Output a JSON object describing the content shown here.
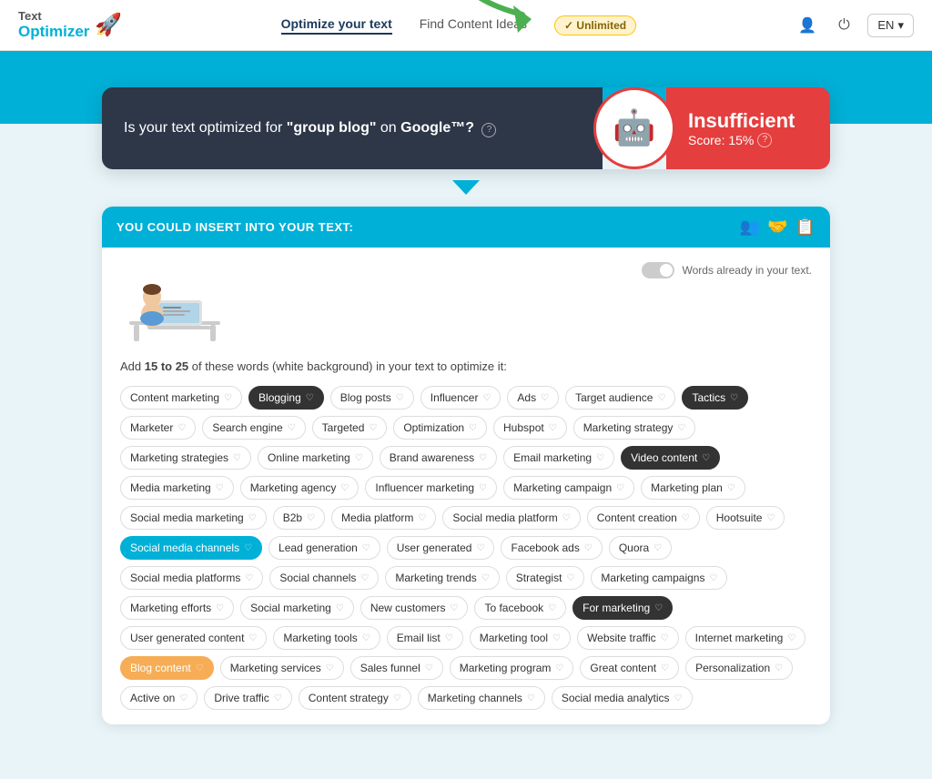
{
  "header": {
    "logo_line1": "Text",
    "logo_line2": "Optimizer",
    "logo_emoji": "🚀",
    "nav": [
      {
        "label": "Optimize your text",
        "active": true
      },
      {
        "label": "Find Content Ideas",
        "active": false
      }
    ],
    "unlimited_label": "✓ Unlimited",
    "icons": [
      "👤",
      "⏻"
    ],
    "lang_label": "EN",
    "lang_chevron": "▾"
  },
  "score_card": {
    "question_text": "Is your text optimized for ",
    "query_bold": "\"group blog\"",
    "question_mid": " on ",
    "google_bold": "Google™?",
    "result_label": "Insufficient",
    "score_label": "Score: 15%"
  },
  "insert_section": {
    "header_text": "YOU COULD INSERT INTO YOUR TEXT:",
    "toggle_label": "Words already in your text.",
    "instruction_pre": "Add ",
    "instruction_bold": "15 to 25",
    "instruction_post": " of these words (white background) in your text to optimize it:",
    "tags": [
      {
        "label": "Content marketing",
        "style": "normal"
      },
      {
        "label": "Blogging",
        "style": "highlighted"
      },
      {
        "label": "Blog posts",
        "style": "normal"
      },
      {
        "label": "Influencer",
        "style": "normal"
      },
      {
        "label": "Ads",
        "style": "normal"
      },
      {
        "label": "Target audience",
        "style": "normal"
      },
      {
        "label": "Tactics",
        "style": "highlighted"
      },
      {
        "label": "Marketer",
        "style": "normal"
      },
      {
        "label": "Search engine",
        "style": "normal"
      },
      {
        "label": "Targeted",
        "style": "normal"
      },
      {
        "label": "Optimization",
        "style": "normal"
      },
      {
        "label": "Hubspot",
        "style": "normal"
      },
      {
        "label": "Marketing strategy",
        "style": "normal"
      },
      {
        "label": "Marketing strategies",
        "style": "normal"
      },
      {
        "label": "Online marketing",
        "style": "normal"
      },
      {
        "label": "Brand awareness",
        "style": "normal"
      },
      {
        "label": "Email marketing",
        "style": "normal"
      },
      {
        "label": "Video content",
        "style": "highlighted"
      },
      {
        "label": "Media marketing",
        "style": "normal"
      },
      {
        "label": "Marketing agency",
        "style": "normal"
      },
      {
        "label": "Influencer marketing",
        "style": "normal"
      },
      {
        "label": "Marketing campaign",
        "style": "normal"
      },
      {
        "label": "Marketing plan",
        "style": "normal"
      },
      {
        "label": "Social media marketing",
        "style": "normal"
      },
      {
        "label": "B2b",
        "style": "normal"
      },
      {
        "label": "Media platform",
        "style": "normal"
      },
      {
        "label": "Social media platform",
        "style": "normal"
      },
      {
        "label": "Content creation",
        "style": "normal"
      },
      {
        "label": "Hootsuite",
        "style": "normal"
      },
      {
        "label": "Social media channels",
        "style": "highlighted-teal"
      },
      {
        "label": "Lead generation",
        "style": "normal"
      },
      {
        "label": "User generated",
        "style": "normal"
      },
      {
        "label": "Facebook ads",
        "style": "normal"
      },
      {
        "label": "Quora",
        "style": "normal"
      },
      {
        "label": "Social media platforms",
        "style": "normal"
      },
      {
        "label": "Social channels",
        "style": "normal"
      },
      {
        "label": "Marketing trends",
        "style": "normal"
      },
      {
        "label": "Strategist",
        "style": "normal"
      },
      {
        "label": "Marketing campaigns",
        "style": "normal"
      },
      {
        "label": "Marketing efforts",
        "style": "normal"
      },
      {
        "label": "Social marketing",
        "style": "normal"
      },
      {
        "label": "New customers",
        "style": "normal"
      },
      {
        "label": "To facebook",
        "style": "normal"
      },
      {
        "label": "For marketing",
        "style": "highlighted"
      },
      {
        "label": "User generated content",
        "style": "normal"
      },
      {
        "label": "Marketing tools",
        "style": "normal"
      },
      {
        "label": "Email list",
        "style": "normal"
      },
      {
        "label": "Marketing tool",
        "style": "normal"
      },
      {
        "label": "Website traffic",
        "style": "normal"
      },
      {
        "label": "Internet marketing",
        "style": "normal"
      },
      {
        "label": "Blog content",
        "style": "highlighted-orange"
      },
      {
        "label": "Marketing services",
        "style": "normal"
      },
      {
        "label": "Sales funnel",
        "style": "normal"
      },
      {
        "label": "Marketing program",
        "style": "normal"
      },
      {
        "label": "Great content",
        "style": "normal"
      },
      {
        "label": "Personalization",
        "style": "normal"
      },
      {
        "label": "Active on",
        "style": "normal"
      },
      {
        "label": "Drive traffic",
        "style": "normal"
      },
      {
        "label": "Content strategy",
        "style": "normal"
      },
      {
        "label": "Marketing channels",
        "style": "normal"
      },
      {
        "label": "Social media analytics",
        "style": "normal"
      }
    ]
  }
}
